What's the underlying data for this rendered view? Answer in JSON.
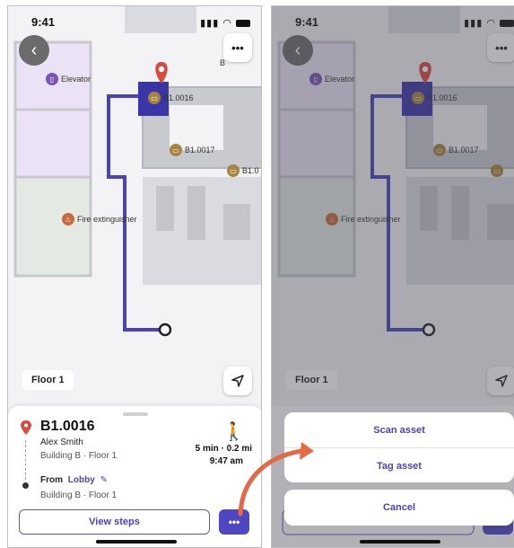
{
  "status_bar": {
    "time": "9:41"
  },
  "map": {
    "pois": {
      "elevator": "Elevator",
      "room_b10016": "B1.0016",
      "room_b10017": "B1.0017",
      "room_b10_partial": "B1.0",
      "fire_extinguisher": "Fire extinguisher"
    },
    "floor_label": "Floor 1",
    "more_label": "•••"
  },
  "sheet": {
    "destination": "B1.0016",
    "person": "Alex Smith",
    "destination_location": "Building B · Floor 1",
    "from_label": "From",
    "from_place": "Lobby",
    "from_location": "Building B · Floor 1",
    "duration_distance": "5 min · 0.2 mi",
    "arrival_time": "9:47 am",
    "view_steps": "View steps",
    "more_label": "•••"
  },
  "action_sheet": {
    "scan_asset": "Scan asset",
    "tag_asset": "Tag asset",
    "cancel": "Cancel"
  },
  "colors": {
    "route": "#4a43b8",
    "accent": "#4f46c3",
    "pin": "#d9493f",
    "annotation_arrow": "#e46a45"
  },
  "icons": [
    "back-arrow-icon",
    "more-icon",
    "location-pin-icon",
    "elevator-icon",
    "room-icon",
    "fire-extinguisher-icon",
    "navigate-arrow-icon",
    "walking-person-icon",
    "edit-pencil-icon"
  ]
}
